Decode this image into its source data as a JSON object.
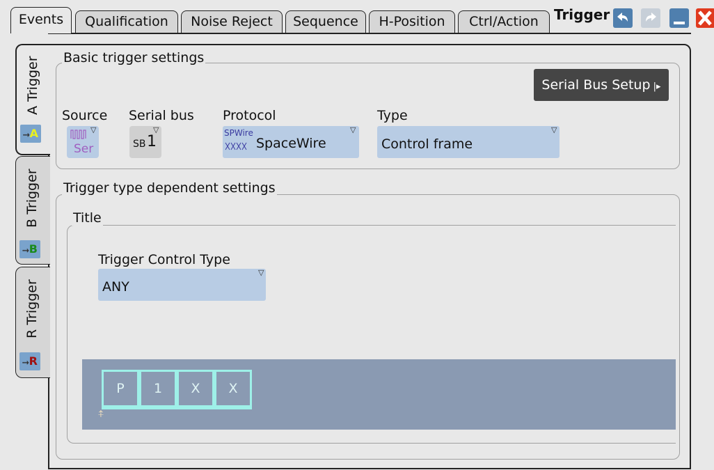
{
  "window": {
    "title": "Trigger",
    "tabs": [
      "Events",
      "Qualification",
      "Noise Reject",
      "Sequence",
      "H-Position",
      "Ctrl/Action"
    ],
    "buttons": {
      "back": "back-arrow-icon",
      "forward": "forward-arrow-icon",
      "minimize": "minimize-icon",
      "close": "close-icon"
    }
  },
  "side_tabs": [
    {
      "label": "A Trigger",
      "badge": "A"
    },
    {
      "label": "B Trigger",
      "badge": "B"
    },
    {
      "label": "R Trigger",
      "badge": "R"
    }
  ],
  "basic": {
    "title": "Basic trigger settings",
    "serial_bus_setup": "Serial Bus Setup",
    "source_label": "Source",
    "source_value": "Ser",
    "serial_bus_label": "Serial bus",
    "serial_bus_prefix": "SB",
    "serial_bus_number": "1",
    "protocol_label": "Protocol",
    "protocol_icon_top": "SPWire",
    "protocol_value": "SpaceWire",
    "type_label": "Type",
    "type_value": "Control frame"
  },
  "dependent": {
    "title": "Trigger type dependent settings",
    "subtitle": "Title",
    "control_type_label": "Trigger Control Type",
    "control_type_value": "ANY",
    "frame_cells": [
      "P",
      "1",
      "X",
      "X"
    ]
  },
  "colors": {
    "accent": "#b8cce4",
    "frame_bg": "#8a9ab2",
    "frame_cell": "#9ef0e8"
  }
}
